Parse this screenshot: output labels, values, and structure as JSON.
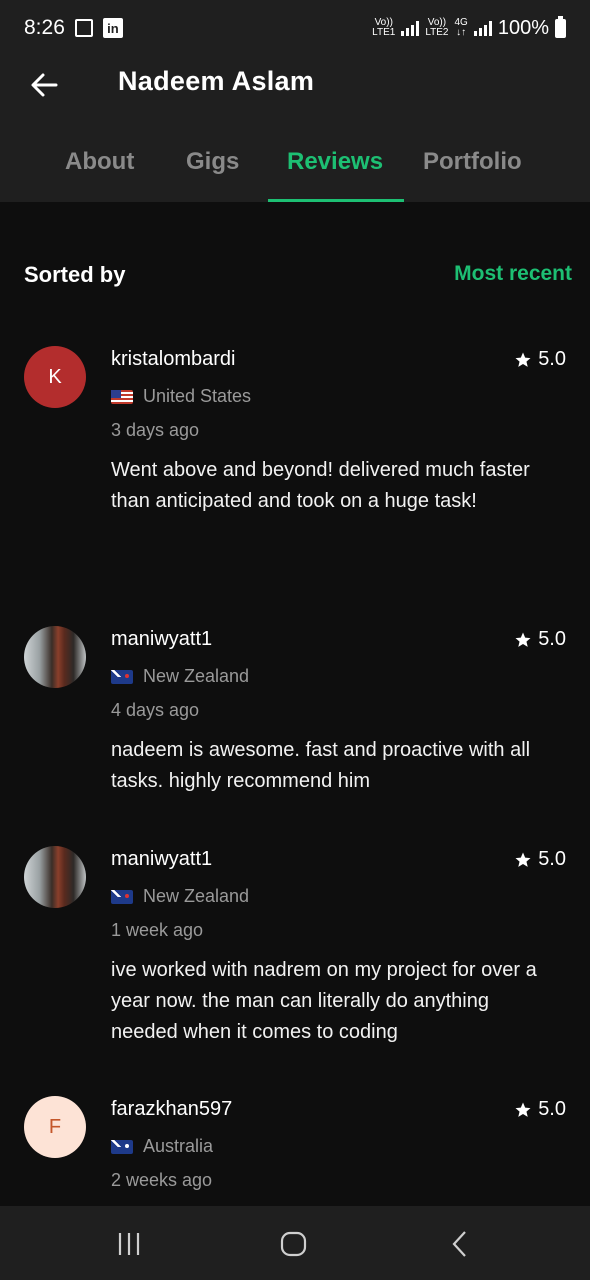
{
  "status": {
    "time": "8:26",
    "network_1": "Vo)) LTE1",
    "network_2": "Vo)) LTE2",
    "network_type": "4G",
    "battery": "100%"
  },
  "header": {
    "title": "Nadeem Aslam",
    "tabs": [
      {
        "label": "About",
        "active": false
      },
      {
        "label": "Gigs",
        "active": false
      },
      {
        "label": "Reviews",
        "active": true
      },
      {
        "label": "Portfolio",
        "active": false
      }
    ]
  },
  "sort": {
    "label": "Sorted by",
    "value": "Most recent"
  },
  "reviews": [
    {
      "initial": "K",
      "avatar_color": "#b32d2d",
      "username": "kristalombardi",
      "rating": "5.0",
      "country": "United States",
      "time": "3 days ago",
      "text": "Went above and beyond! delivered much faster than anticipated and took on a huge task!"
    },
    {
      "initial": "",
      "username": "maniwyatt1",
      "rating": "5.0",
      "country": "New Zealand",
      "time": "4 days ago",
      "text": "nadeem is awesome. fast and proactive with all tasks. highly recommend him"
    },
    {
      "initial": "",
      "username": "maniwyatt1",
      "rating": "5.0",
      "country": "New Zealand",
      "time": "1 week ago",
      "text": "ive worked with nadrem on my project for over a year now. the man can literally do anything needed when it comes to coding"
    },
    {
      "initial": "F",
      "avatar_color": "#fde3d6",
      "username": "farazkhan597",
      "rating": "5.0",
      "country": "Australia",
      "time": "2 weeks ago",
      "text": ""
    }
  ],
  "colors": {
    "accent": "#1dbf73",
    "background": "#0e0e0e",
    "header_bg": "#1f1f1f"
  }
}
